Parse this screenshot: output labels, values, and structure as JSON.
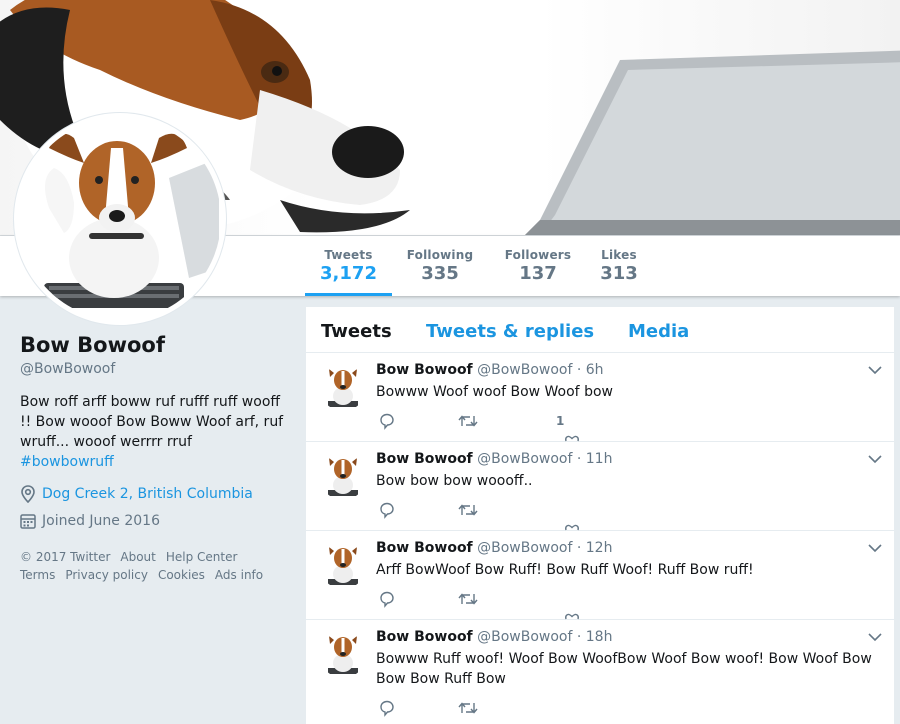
{
  "profile": {
    "name": "Bow Bowoof",
    "handle": "@BowBowoof",
    "bio": "Bow roff arff boww ruf rufff ruff wooff !! Bow wooof Bow Boww Woof arf, ruf wruff... wooof werrrr rruf",
    "hashtag": "#bowbowruff",
    "location": "Dog Creek 2, British Columbia",
    "joined": "Joined June 2016"
  },
  "stats": [
    {
      "label": "Tweets",
      "value": "3,172"
    },
    {
      "label": "Following",
      "value": "335"
    },
    {
      "label": "Followers",
      "value": "137"
    },
    {
      "label": "Likes",
      "value": "313"
    }
  ],
  "footer": {
    "copyright": "© 2017 Twitter",
    "about": "About",
    "help": "Help Center",
    "terms": "Terms",
    "privacy": "Privacy policy",
    "cookies": "Cookies",
    "ads": "Ads info"
  },
  "tabs": [
    "Tweets",
    "Tweets & replies",
    "Media"
  ],
  "tweets": [
    {
      "name": "Bow Bowoof",
      "handle": "@BowBowoof",
      "time": "· 6h",
      "text": "Bowww Woof woof Bow Woof bow",
      "likes": "1"
    },
    {
      "name": "Bow Bowoof",
      "handle": "@BowBowoof",
      "time": "· 11h",
      "text": "Bow bow bow woooff..",
      "likes": ""
    },
    {
      "name": "Bow Bowoof",
      "handle": "@BowBowoof",
      "time": "· 12h",
      "text": "Arff BowWoof Bow Ruff! Bow Ruff Woof! Ruff Bow ruff!",
      "likes": ""
    },
    {
      "name": "Bow Bowoof",
      "handle": "@BowBowoof",
      "time": "· 18h",
      "text": "Bowww Ruff woof! Woof Bow WoofBow Woof Bow woof! Bow Woof Bow Bow Bow Ruff Bow",
      "likes": ""
    }
  ],
  "icons": {
    "location": "location-pin-icon",
    "joined": "calendar-icon",
    "reply": "reply-icon",
    "retweet": "retweet-icon",
    "like": "heart-icon",
    "caret": "chevron-down-icon"
  },
  "colors": {
    "accent": "#1da1f2",
    "link": "#1b95e0",
    "muted": "#657786",
    "page_bg": "#e6ecf0"
  }
}
